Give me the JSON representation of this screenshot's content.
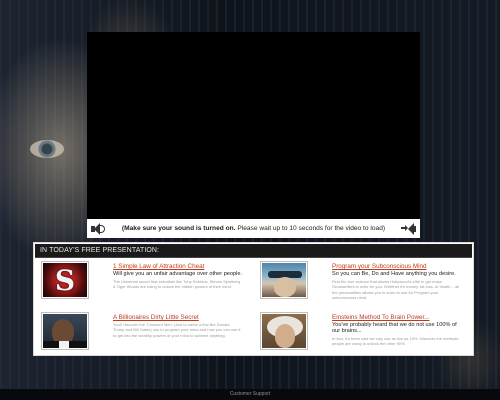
{
  "video": {
    "notice_bold": "(Make sure your sound is turned on.",
    "notice_rest": " Please wait up to 10 seconds for the video to load)"
  },
  "presentation": {
    "header": "IN TODAY'S FREE PRESENTATION:",
    "items": [
      {
        "title": "1 Simple Law of Attraction Cheat",
        "subtitle": "Will give you an unfair advantage over other people.",
        "description": "The Universal secret that scientists like Tony Robbins, Steven Spielberg & Tiger Woods are using to unlock the hidden powers of their mind.",
        "image_icon": "letter-s-logo"
      },
      {
        "title": "Program your Subconscious Mind",
        "subtitle": "So you can Be, Do and Have anything you desire.",
        "description": "Find the true science that allows Hollywood's elite to get mass Ghostwriters to write for you. Whether it's money, fat loss, or health... all the personalities allows you to learn to use for Program your subconscious mind.",
        "image_icon": "brain-headset-photo"
      },
      {
        "title": "A Billionaires Dirty Little Secret",
        "subtitle": "",
        "description": "You'll discover the 'Crowned Men' (Just to name a few like Donald Trump and Bill Gates) use to program your mind and how you can use it to get into the wealthy powers of your mind to achieve anything.",
        "image_icon": "obama-photo"
      },
      {
        "title": "Einsteins Method To Brain Power...",
        "subtitle": "You've probably heard that we do not use 100% of our brains...",
        "description": "In fact, it's been said we only use as low as 10%. Discover the methods people are using to unlock the other 90%.",
        "image_icon": "einstein-photo"
      }
    ]
  },
  "footer": {
    "link": "Customer Support"
  },
  "colors": {
    "title_link": "#c0391b",
    "panel_header_bg": "#1a1a1a",
    "footer_bg": "#07090c"
  }
}
